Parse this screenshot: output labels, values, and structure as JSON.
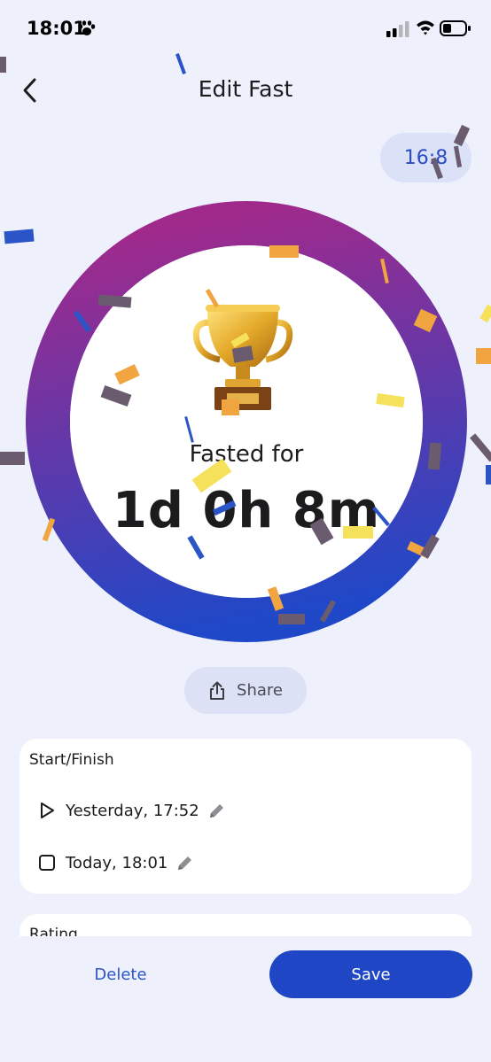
{
  "status_bar": {
    "time": "18:01"
  },
  "header": {
    "title": "Edit Fast"
  },
  "plan": {
    "label": "16:8"
  },
  "progress": {
    "fasted_label": "Fasted for",
    "fasted_value": "1d 0h 8m",
    "fraction_complete": 1.0,
    "gradient_top": "#a02a8c",
    "gradient_bottom": "#1f48c8"
  },
  "share": {
    "label": "Share"
  },
  "start_finish": {
    "title": "Start/Finish",
    "start": "Yesterday, 17:52",
    "finish": "Today, 18:01"
  },
  "rating": {
    "title": "Rating"
  },
  "actions": {
    "delete_label": "Delete",
    "save_label": "Save"
  },
  "colors": {
    "accent": "#1f47c5",
    "background": "#eef0fb"
  }
}
